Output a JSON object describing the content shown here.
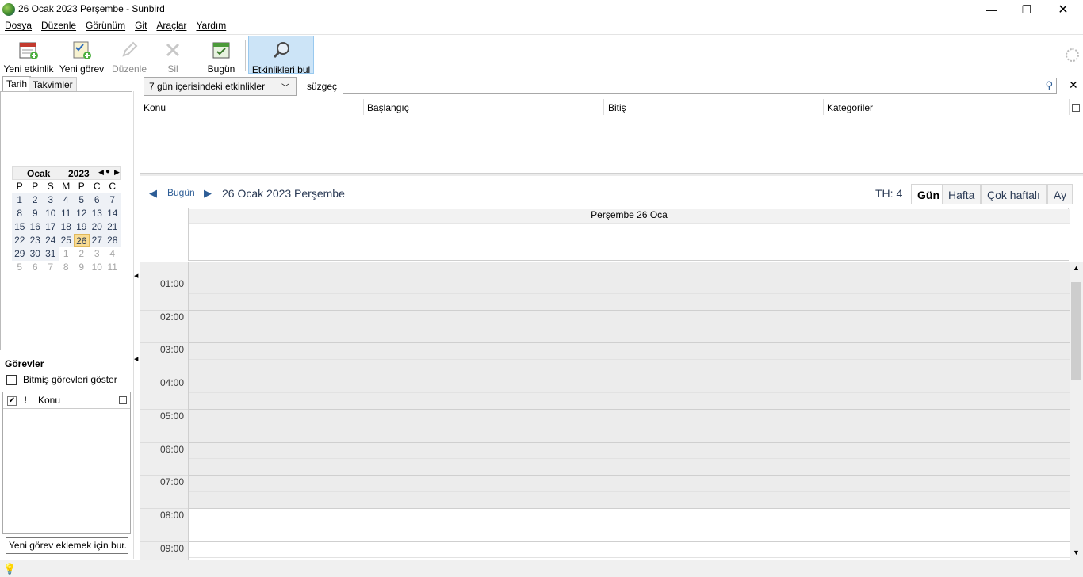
{
  "window": {
    "title": "26 Ocak 2023 Perşembe - Sunbird",
    "controls": {
      "minimize": "—",
      "maximize": "❐",
      "close": "✕"
    }
  },
  "menu": [
    "Dosya",
    "Düzenle",
    "Görünüm",
    "Git",
    "Araçlar",
    "Yardım"
  ],
  "toolbar": {
    "new_event": "Yeni etkinlik",
    "new_task": "Yeni görev",
    "edit": "Düzenle",
    "delete": "Sil",
    "today": "Bugün",
    "find_events": "Etkinlikleri bul"
  },
  "left_tabs": {
    "date": "Tarih",
    "calendars": "Takvimler"
  },
  "minical": {
    "month": "Ocak",
    "year": "2023",
    "nav_prev": "◀",
    "nav_today": "●",
    "nav_next": "▶",
    "dow": [
      "P",
      "P",
      "S",
      "M",
      "P",
      "C",
      "C"
    ],
    "weeks": [
      [
        {
          "d": "1",
          "t": "cur"
        },
        {
          "d": "2",
          "t": "cur"
        },
        {
          "d": "3",
          "t": "cur"
        },
        {
          "d": "4",
          "t": "cur"
        },
        {
          "d": "5",
          "t": "cur"
        },
        {
          "d": "6",
          "t": "cur"
        },
        {
          "d": "7",
          "t": "cur"
        }
      ],
      [
        {
          "d": "8",
          "t": "cur"
        },
        {
          "d": "9",
          "t": "cur"
        },
        {
          "d": "10",
          "t": "cur"
        },
        {
          "d": "11",
          "t": "cur"
        },
        {
          "d": "12",
          "t": "cur"
        },
        {
          "d": "13",
          "t": "cur"
        },
        {
          "d": "14",
          "t": "cur"
        }
      ],
      [
        {
          "d": "15",
          "t": "cur"
        },
        {
          "d": "16",
          "t": "cur"
        },
        {
          "d": "17",
          "t": "cur"
        },
        {
          "d": "18",
          "t": "cur"
        },
        {
          "d": "19",
          "t": "cur"
        },
        {
          "d": "20",
          "t": "cur"
        },
        {
          "d": "21",
          "t": "cur"
        }
      ],
      [
        {
          "d": "22",
          "t": "cur"
        },
        {
          "d": "23",
          "t": "cur"
        },
        {
          "d": "24",
          "t": "cur"
        },
        {
          "d": "25",
          "t": "cur"
        },
        {
          "d": "26",
          "t": "today"
        },
        {
          "d": "27",
          "t": "cur"
        },
        {
          "d": "28",
          "t": "cur"
        }
      ],
      [
        {
          "d": "29",
          "t": "cur"
        },
        {
          "d": "30",
          "t": "cur"
        },
        {
          "d": "31",
          "t": "cur"
        },
        {
          "d": "1",
          "t": "other"
        },
        {
          "d": "2",
          "t": "other"
        },
        {
          "d": "3",
          "t": "other"
        },
        {
          "d": "4",
          "t": "other"
        }
      ],
      [
        {
          "d": "5",
          "t": "other"
        },
        {
          "d": "6",
          "t": "other"
        },
        {
          "d": "7",
          "t": "other"
        },
        {
          "d": "8",
          "t": "other"
        },
        {
          "d": "9",
          "t": "other"
        },
        {
          "d": "10",
          "t": "other"
        },
        {
          "d": "11",
          "t": "other"
        }
      ]
    ]
  },
  "tasks": {
    "title": "Görevler",
    "show_completed": "Bitmiş görevleri göster",
    "priority_col": "!",
    "subject_col": "Konu",
    "new_task_placeholder": "Yeni görev eklemek için bur..."
  },
  "filter": {
    "selected": "7 gün içerisindeki etkinlikler",
    "label": "süzgeç",
    "search_value": ""
  },
  "event_list": {
    "columns": [
      "Konu",
      "Başlangıç",
      "Bitiş",
      "Kategoriler"
    ]
  },
  "day_view": {
    "prev": "◀",
    "today": "Bugün",
    "next": "▶",
    "date": "26 Ocak 2023 Perşembe",
    "week_number": "TH: 4",
    "views": [
      "Gün",
      "Hafta",
      "Çok haftalı",
      "Ay"
    ],
    "selected_view": "Gün",
    "column_header": "Perşembe 26 Oca",
    "hours": [
      "01:00",
      "02:00",
      "03:00",
      "04:00",
      "05:00",
      "06:00",
      "07:00",
      "08:00",
      "09:00"
    ],
    "offhours_end": "08:00"
  },
  "colors": {
    "link": "#2d5d96",
    "today_bg": "#f9dc93",
    "active_tool_bg": "#cce4f7"
  }
}
